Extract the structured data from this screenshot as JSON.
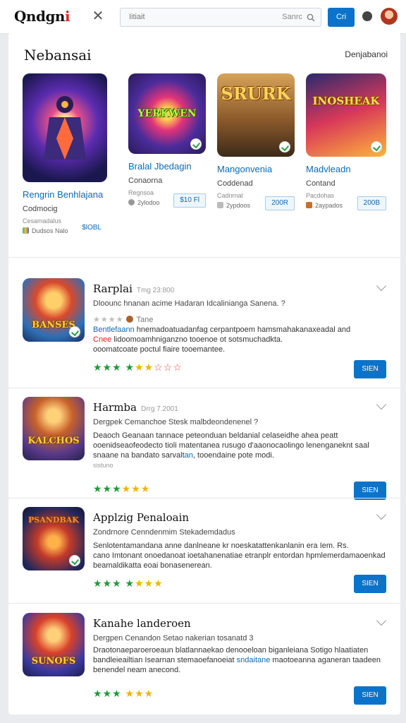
{
  "header": {
    "logo_main": "Qndgn",
    "logo_accent": "i",
    "search_value": "Iitiait",
    "search_hint": "Sanrc",
    "go_label": "Cri"
  },
  "featured": {
    "title": "Nebansai",
    "see_all": "Denjabanoi",
    "items": [
      {
        "name": "Rengrin Benhlajana",
        "cat": "Codmocig",
        "line1": "Cesamadalus",
        "line2": "Dudsos   Nalo",
        "price": "$lOBL",
        "thumb_text": ""
      },
      {
        "name": "Bralal Jbedagin",
        "cat": "Conaorna",
        "line1": "Regnsoa",
        "line2": "2ylodoo",
        "price": "$10 Fl",
        "thumb_text": "YERKWEN"
      },
      {
        "name": "Mangonvenia",
        "cat": "Coddenad",
        "line1": "Cadnrnal",
        "line2": "2ypdoos",
        "price": "200R",
        "thumb_text": "SRURK"
      },
      {
        "name": "Madvleadn",
        "cat": "Contand",
        "line1": "Pacdohas",
        "line2": "2aypados",
        "price": "200B",
        "thumb_text": "INOSHEAK"
      }
    ]
  },
  "list": [
    {
      "title": "Rarplai",
      "date": "Tmg 23:800",
      "sub": "Dloounc hnanan acime Hadaran Idcalinianga Sanena. ?",
      "rating_text": "Tane",
      "desc1_lnk": "Bentlefaann",
      "desc1": " hnemadoatuadanfag cerpantpoem hamsmahakanaxeadal and",
      "desc2_red": "Cnee",
      "desc2": " lidoomoamhniganzno tooenoe ot sotsmuchadkta.",
      "desc3": "ooomatcoate poctul fiaire tooemantee.",
      "button": "SIEN",
      "icon_text": "BANSES",
      "stars": [
        "g",
        "g",
        "g",
        "g",
        "y",
        "y",
        "r",
        "r",
        "r"
      ]
    },
    {
      "title": "Harmba",
      "date": "Drrg 7.2001",
      "sub": "Dergpek Cemanchoe Stesk malbdeondenenel ?",
      "desc1": "Deaoch Geanaan tannace peteonduan beldanial celaseidhe ahea peatt",
      "desc2": "ooenidseaofeodecto tioli matentanea rusugo d'aaonocaolingo lenenganeknt saal",
      "desc3_pre": "snaane na bandato sarvalt",
      "desc3_lnk": "an",
      "desc3": ", tooendaine pote modi.",
      "desc4": "sistuno",
      "button": "SIEN",
      "icon_text": "KALCHOS",
      "stars": [
        "g",
        "g",
        "g",
        "y",
        "y",
        "y"
      ]
    },
    {
      "title": "Applzig Penaloain",
      "date": "",
      "sub": "Zondrnore Cenndenmim Stekademdadus",
      "desc1": "Senlotentamandana anne danlneane kr noeskatattenkanlanin era Iem. Rs.",
      "desc2": "cano Imtonant onoedanoat ioetahanenatiae etranplr entordan hpmlemerdamaoenkad",
      "desc3": "beamaldikatta eoai bonasenerean.",
      "button": "SIEN",
      "icon_text": "PSANDBAK",
      "stars": [
        "g",
        "g",
        "g",
        "g",
        "y",
        "y",
        "y"
      ]
    },
    {
      "title": "Kanahe landeroen",
      "date": "",
      "sub": "Dergpen Cenandon Setao nakerian tosanatd 3",
      "desc1": "Draotonaeparoeroeaun blatlannaekao denooeloan biganleiana Sotigo hlaatiaten",
      "desc2_pre": "bandleieailtian Isearnan stemaoefanoeiat",
      "desc2_lnk": "sndaitane",
      "desc2": " maotoeanna aganeran taadeen",
      "desc3": "benendel neam anecond.",
      "button": "SIEN",
      "icon_text": "SUNOFS",
      "stars": [
        "g",
        "g",
        "g",
        "y",
        "y",
        "y"
      ]
    }
  ],
  "colors": {
    "accent": "#0b73c9",
    "link": "#0a6bb5",
    "brand_red": "#e02424",
    "star_green": "#1e9a3a",
    "star_yellow": "#f0b400"
  }
}
